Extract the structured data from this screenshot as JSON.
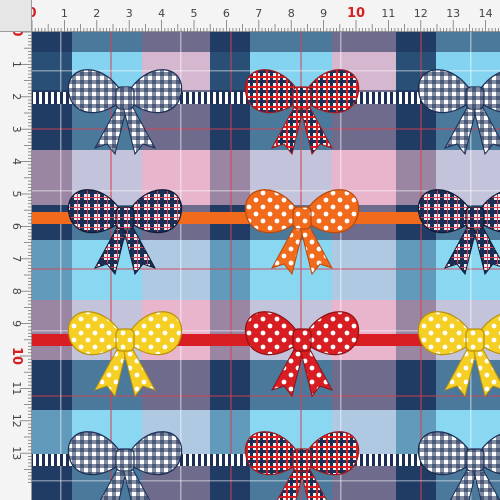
{
  "rulers": {
    "top": {
      "labels": [
        "0",
        "1",
        "2",
        "3",
        "4",
        "5",
        "6",
        "7",
        "8",
        "9",
        "10",
        "11",
        "12",
        "13",
        "14"
      ],
      "major": [
        "0",
        "10"
      ]
    },
    "left": {
      "labels": [
        "0",
        "1",
        "2",
        "3",
        "4",
        "5",
        "6",
        "7",
        "8",
        "9",
        "10",
        "11",
        "12",
        "13"
      ],
      "major": [
        "0",
        "10"
      ]
    }
  },
  "fabric": {
    "pattern": "tartan-plaid-with-bows",
    "colors": {
      "navy": "#1b2e55",
      "sky_blue": "#5cc4ec",
      "light_blue": "#8fd8f2",
      "pink": "#f7b4c8",
      "light_pink": "#f9c9d6",
      "red_stripe": "#d64050",
      "orange": "#f26a1b",
      "red": "#d81e22",
      "yellow": "#f5cf23",
      "white": "#ffffff"
    },
    "bow_rows": [
      {
        "bows": [
          "navy-gingham-icon",
          "red-plaid-icon",
          "navy-gingham-icon"
        ]
      },
      {
        "bows": [
          "navy-plaid-icon",
          "orange-polka-icon",
          "navy-plaid-icon"
        ]
      },
      {
        "bows": [
          "yellow-polka-icon",
          "red-polka-icon",
          "yellow-polka-icon"
        ]
      },
      {
        "bows": [
          "navy-gingham-icon",
          "red-plaid-icon",
          "navy-gingham-icon"
        ]
      }
    ]
  }
}
